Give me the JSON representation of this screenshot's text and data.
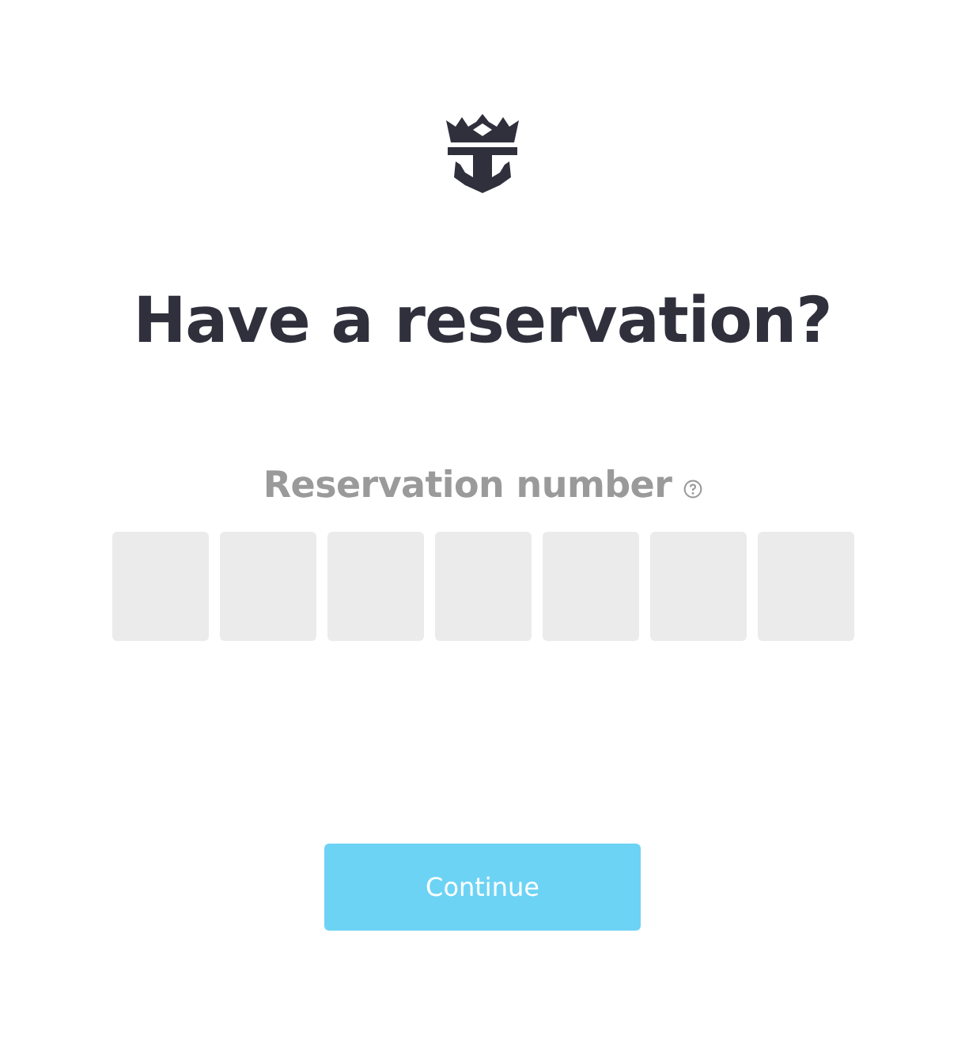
{
  "heading": "Have a reservation?",
  "field": {
    "label": "Reservation number"
  },
  "digit_fields": [
    {
      "kind": "digit"
    },
    {
      "kind": "digit"
    },
    {
      "kind": "digit"
    },
    {
      "kind": "digit"
    },
    {
      "kind": "digit"
    },
    {
      "kind": "digit"
    },
    {
      "kind": "digit"
    }
  ],
  "button": {
    "label": "Continue",
    "disabled": true
  }
}
